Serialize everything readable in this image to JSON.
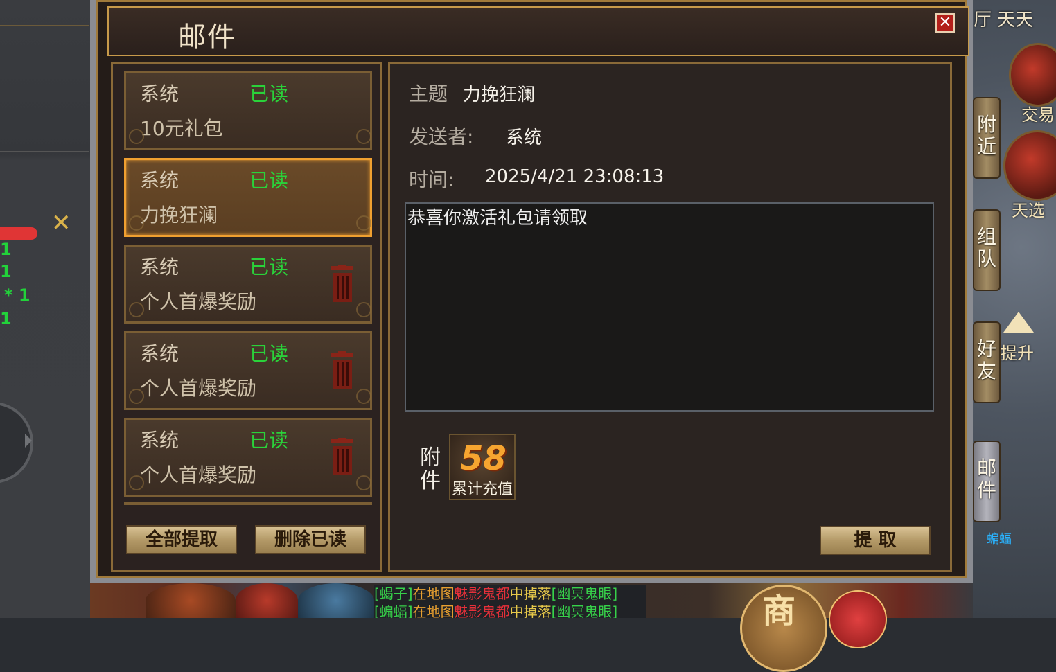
{
  "dialog": {
    "title": "邮件",
    "close": "✕"
  },
  "mail_list": [
    {
      "sender": "系统",
      "status": "已读",
      "subject": "10元礼包",
      "has_delete": false,
      "selected": false
    },
    {
      "sender": "系统",
      "status": "已读",
      "subject": "力挽狂澜",
      "has_delete": false,
      "selected": true
    },
    {
      "sender": "系统",
      "status": "已读",
      "subject": "个人首爆奖励",
      "has_delete": true,
      "selected": false
    },
    {
      "sender": "系统",
      "status": "已读",
      "subject": "个人首爆奖励",
      "has_delete": true,
      "selected": false
    },
    {
      "sender": "系统",
      "status": "已读",
      "subject": "个人首爆奖励",
      "has_delete": true,
      "selected": false
    }
  ],
  "list_buttons": {
    "claim_all": "全部提取",
    "delete_read": "删除已读"
  },
  "detail": {
    "subject_label": "主题",
    "subject": "力挽狂澜",
    "sender_label": "发送者:",
    "sender": "系统",
    "time_label": "时间:",
    "time": "2025/4/21 23:08:13",
    "body": "恭喜你激活礼包请领取",
    "attachment_label": "附件",
    "attachment": {
      "number": "58",
      "caption": "累计充值"
    },
    "claim_button": "提 取"
  },
  "right_sidebar": {
    "map_title": "厅  天天",
    "trade": "交易",
    "pick": "天选",
    "upgrade": "提升",
    "bat": "蝙蝠",
    "tabs": [
      {
        "label": "附近",
        "active": false
      },
      {
        "label": "组队",
        "active": false
      },
      {
        "label": "好友",
        "active": false
      },
      {
        "label": "邮件",
        "active": true
      }
    ]
  },
  "left_hud": {
    "stats": [
      "1",
      "1",
      "* 1",
      "1"
    ],
    "close_mark": "✕"
  },
  "bottom": {
    "shop": "商",
    "drop_log": [
      {
        "monster": "[蝎子]",
        "in": "在地图",
        "map": "魅影鬼都",
        "drop": "中掉落",
        "item": "[幽冥鬼眼]"
      },
      {
        "monster": "[蝙蝠]",
        "in": "在地图",
        "map": "魅影鬼都",
        "drop": "中掉落",
        "item": "[幽冥鬼眼]"
      }
    ]
  },
  "colors": {
    "read_status": "#2ad23a",
    "selected_border": "#f0a030",
    "close_red": "#b21f1a",
    "gold_frame": "#a07a3a"
  }
}
